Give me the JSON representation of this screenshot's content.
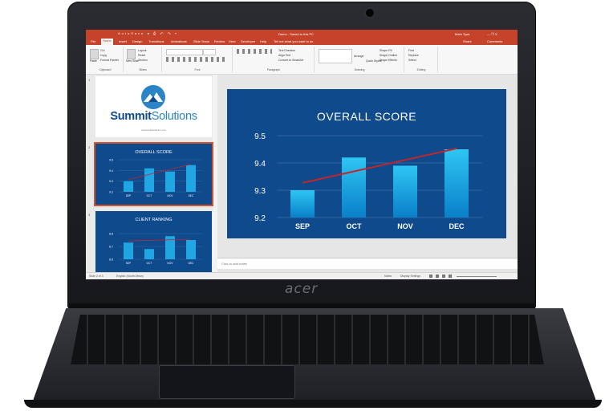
{
  "device": {
    "brand": "acer"
  },
  "window": {
    "quick_access": "AutoSave ● ⎙ ↶ ↷ ▾",
    "title": "Demo - Saved to this PC",
    "user": "Mark Tyas",
    "controls": "—  ❐  ✕",
    "share": "Share",
    "comments": "Comments"
  },
  "tabs": [
    "File",
    "Home",
    "Insert",
    "Design",
    "Transitions",
    "Animations",
    "Slide Show",
    "Review",
    "View",
    "Developer",
    "Help",
    "Tell me what you want to do"
  ],
  "ribbon": {
    "clipboard": {
      "label": "Clipboard",
      "paste": "Paste",
      "cut": "Cut",
      "copy": "Copy",
      "format_painter": "Format Painter"
    },
    "slides": {
      "label": "Slides",
      "new_slide": "New Slide",
      "layout": "Layout",
      "reset": "Reset",
      "section": "Section"
    },
    "font": {
      "label": "Font"
    },
    "paragraph": {
      "label": "Paragraph",
      "text_direction": "Text Direction",
      "align_text": "Align Text",
      "convert": "Convert to SmartArt"
    },
    "drawing": {
      "label": "Drawing",
      "arrange": "Arrange",
      "quick_styles": "Quick Styles",
      "shape_fill": "Shape Fill",
      "shape_outline": "Shape Outline",
      "shape_effects": "Shape Effects"
    },
    "editing": {
      "label": "Editing",
      "find": "Find",
      "replace": "Replace",
      "select": "Select"
    }
  },
  "thumbnails": [
    {
      "num": "1",
      "logo": "SummitSolutions",
      "logo_part1": "Summit",
      "logo_part2": "Solutions",
      "url": "www.summitsolutions.co.za"
    },
    {
      "num": "2",
      "title": "OVERALL SCORE",
      "categories": [
        "SEP",
        "OCT",
        "NOV",
        "DEC"
      ],
      "ticks": [
        "9.5",
        "9.4",
        "9.3",
        "9.2"
      ]
    },
    {
      "num": "3",
      "title": "CLIENT RANKING",
      "categories": [
        "SEP",
        "OCT",
        "NOV",
        "DEC"
      ],
      "ticks": [
        "8.8",
        "8.7",
        "8.6"
      ]
    }
  ],
  "notes": {
    "placeholder": "Click to add notes"
  },
  "status": {
    "slide": "Slide 2 of 3",
    "language": "English (South Africa)",
    "notes": "Notes",
    "display": "Display Settings"
  },
  "colors": {
    "accent": "#c4432a",
    "slide_bg": "#0f4a8c",
    "bar_top": "#2ec6f2",
    "bar_bottom": "#0a7fc9",
    "trend": "#c0262c"
  },
  "chart_data": {
    "type": "bar",
    "title": "OVERALL SCORE",
    "categories": [
      "SEP",
      "OCT",
      "NOV",
      "DEC"
    ],
    "values": [
      9.3,
      9.42,
      9.39,
      9.45
    ],
    "trendline": true,
    "ylim": [
      9.2,
      9.5
    ],
    "yticks": [
      "9.5",
      "9.4",
      "9.3",
      "9.2"
    ],
    "grid": true
  }
}
